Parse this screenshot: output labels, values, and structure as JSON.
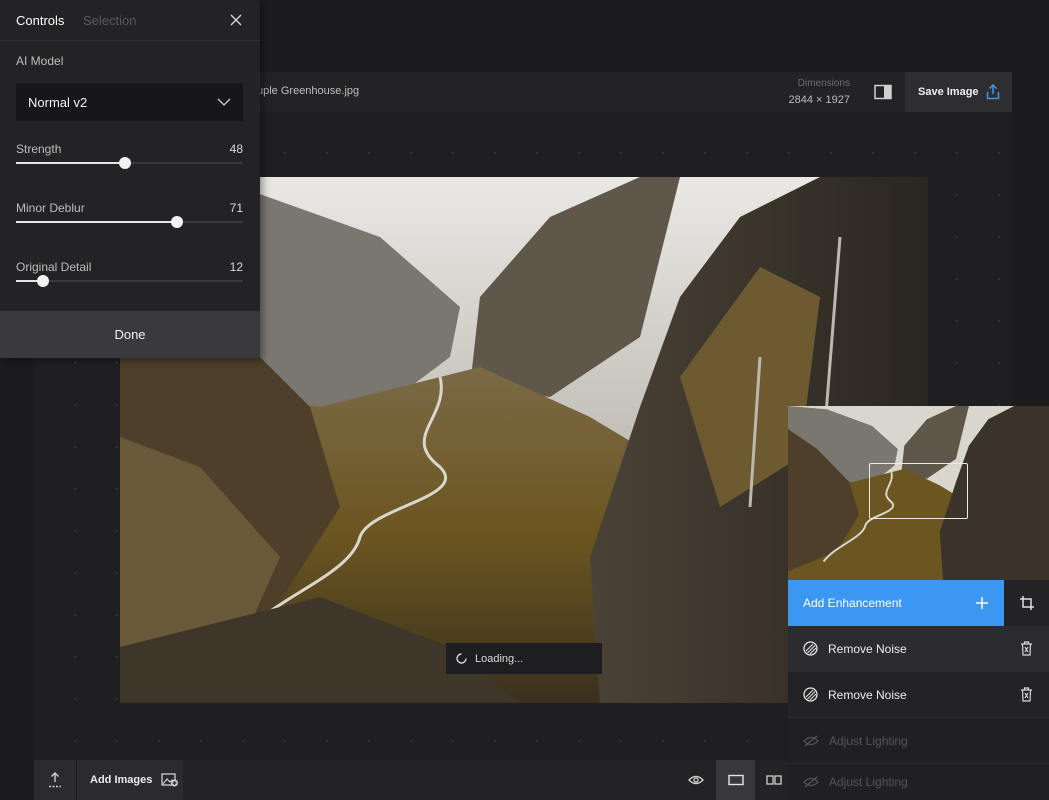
{
  "controls_panel": {
    "tabs": {
      "controls": "Controls",
      "selection": "Selection"
    },
    "ai_model_label": "AI Model",
    "ai_model_value": "Normal v2",
    "sliders": [
      {
        "label": "Strength",
        "value": "48",
        "level": 0.48
      },
      {
        "label": "Minor Deblur",
        "value": "71",
        "level": 0.71
      },
      {
        "label": "Original Detail",
        "value": "12",
        "level": 0.12
      }
    ],
    "done_label": "Done"
  },
  "topbar": {
    "filename": "uple Greenhouse.jpg",
    "dimensions_label": "Dimensions",
    "dimensions_value": "2844 × 1927",
    "save_label": "Save Image"
  },
  "canvas": {
    "loading_text": "Loading..."
  },
  "bottombar": {
    "add_images_label": "Add Images"
  },
  "enhancements": {
    "add_label": "Add Enhancement",
    "items": [
      {
        "label": "Remove Noise",
        "state": "active"
      },
      {
        "label": "Remove Noise",
        "state": "normal"
      },
      {
        "label": "Adjust Lighting",
        "state": "disabled"
      },
      {
        "label": "Adjust Lighting",
        "state": "disabled"
      }
    ]
  },
  "colors": {
    "accent": "#3c97f2",
    "panel": "#232325",
    "background": "#1c1c1e"
  },
  "icons": [
    "close-icon",
    "chevron-down-icon",
    "split-view-icon",
    "share-icon",
    "upload-icon",
    "add-image-icon",
    "eye-icon",
    "single-view-icon",
    "compare-view-icon",
    "plus-icon",
    "crop-icon",
    "noise-icon",
    "trash-icon",
    "lighting-icon",
    "spinner-icon"
  ]
}
